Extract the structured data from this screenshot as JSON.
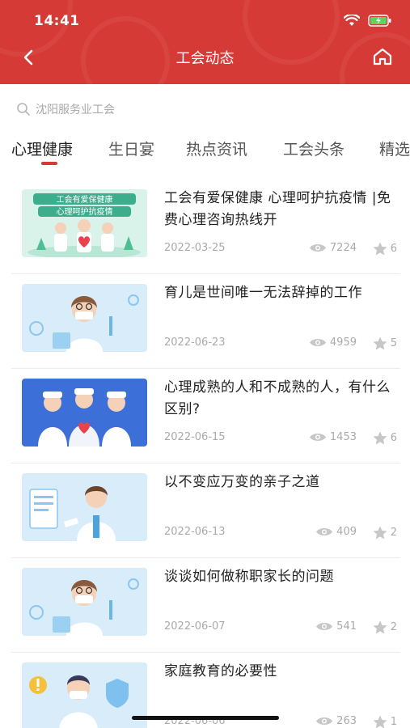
{
  "status_bar": {
    "time": "14:41"
  },
  "nav": {
    "title": "工会动态"
  },
  "search": {
    "placeholder": "沈阳服务业工会"
  },
  "tabs": [
    {
      "label": "心理健康",
      "active": true
    },
    {
      "label": "生日宴",
      "active": false
    },
    {
      "label": "热点资讯",
      "active": false
    },
    {
      "label": "工会头条",
      "active": false
    },
    {
      "label": "精选",
      "active": false
    }
  ],
  "news": [
    {
      "title": "工会有爱保健康 心理呵护抗疫情 |免费心理咨询热线开",
      "date": "2022-03-25",
      "views": "7224",
      "stars": "6",
      "thumb_text": "工会有爱保健康 心理呵护抗疫情"
    },
    {
      "title": "育儿是世间唯一无法辞掉的工作",
      "date": "2022-06-23",
      "views": "4959",
      "stars": "5"
    },
    {
      "title": "心理成熟的人和不成熟的人，有什么区别?",
      "date": "2022-06-15",
      "views": "1453",
      "stars": "6"
    },
    {
      "title": "以不变应万变的亲子之道",
      "date": "2022-06-13",
      "views": "409",
      "stars": "2"
    },
    {
      "title": "谈谈如何做称职家长的问题",
      "date": "2022-06-07",
      "views": "541",
      "stars": "2"
    },
    {
      "title": "家庭教育的必要性",
      "date": "2022-06-06",
      "views": "263",
      "stars": "1"
    }
  ],
  "colors": {
    "brand_red": "#d63a36",
    "muted": "#aaaaaa"
  }
}
